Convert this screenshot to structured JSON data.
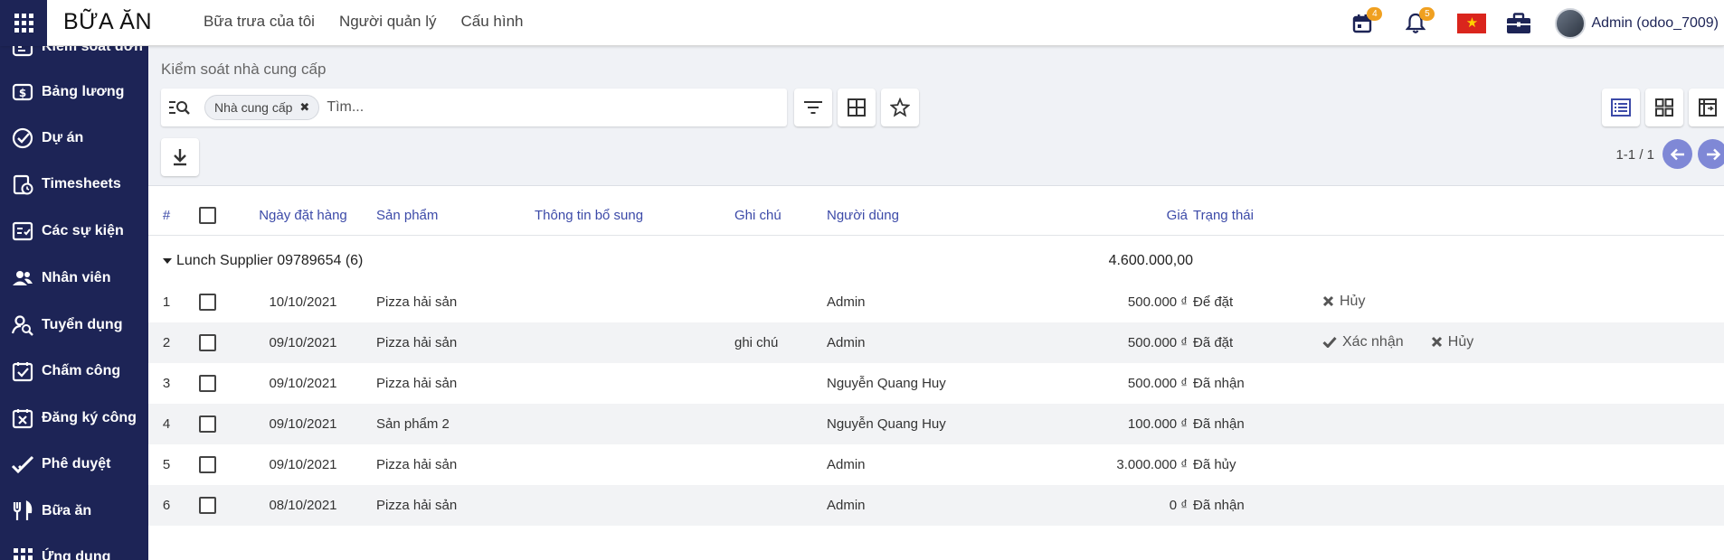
{
  "app": {
    "title": "BỮA ĂN",
    "menu": [
      "Bữa trưa của tôi",
      "Người quản lý",
      "Cấu hình"
    ],
    "activity_badge": "4",
    "notification_badge": "5",
    "user": "Admin (odoo_7009)"
  },
  "sidebar": {
    "items": [
      {
        "label": "Kiểm soát đơn",
        "icon": "order-control-icon"
      },
      {
        "label": "Bảng lương",
        "icon": "payroll-icon"
      },
      {
        "label": "Dự án",
        "icon": "project-check-icon"
      },
      {
        "label": "Timesheets",
        "icon": "timesheet-icon"
      },
      {
        "label": "Các sự kiện",
        "icon": "events-icon"
      },
      {
        "label": "Nhân viên",
        "icon": "employees-icon"
      },
      {
        "label": "Tuyển dụng",
        "icon": "recruitment-icon"
      },
      {
        "label": "Chấm công",
        "icon": "attendance-icon"
      },
      {
        "label": "Đăng ký công",
        "icon": "time-off-icon"
      },
      {
        "label": "Phê duyệt",
        "icon": "approval-icon"
      },
      {
        "label": "Bữa ăn",
        "icon": "lunch-icon"
      },
      {
        "label": "Ứng dụng",
        "icon": "apps-icon"
      }
    ]
  },
  "control_panel": {
    "breadcrumb": "Kiểm soát nhà cung cấp",
    "facet": "Nhà cung cấp",
    "search_placeholder": "Tìm...",
    "pager": "1-1 / 1"
  },
  "table": {
    "headers": {
      "num": "#",
      "date": "Ngày đặt hàng",
      "product": "Sản phẩm",
      "extra": "Thông tin bổ sung",
      "note": "Ghi chú",
      "user": "Người dùng",
      "price": "Giá",
      "state": "Trạng thái"
    },
    "group": {
      "label": "Lunch Supplier 09789654 (6)",
      "total": "4.600.000,00"
    },
    "rows": [
      {
        "n": "1",
        "date": "10/10/2021",
        "product": "Pizza hải sản",
        "note": "",
        "user": "Admin",
        "price": "500.000 ₫",
        "state": "Để đặt",
        "actions": [
          "Hủy"
        ]
      },
      {
        "n": "2",
        "date": "09/10/2021",
        "product": "Pizza hải sản",
        "note": "ghi chú",
        "user": "Admin",
        "price": "500.000 ₫",
        "state": "Đã đặt",
        "actions": [
          "Xác nhận",
          "Hủy"
        ]
      },
      {
        "n": "3",
        "date": "09/10/2021",
        "product": "Pizza hải sản",
        "note": "",
        "user": "Nguyễn Quang Huy",
        "price": "500.000 ₫",
        "state": "Đã nhận",
        "actions": []
      },
      {
        "n": "4",
        "date": "09/10/2021",
        "product": "Sản phẩm 2",
        "note": "",
        "user": "Nguyễn Quang Huy",
        "price": "100.000 ₫",
        "state": "Đã nhận",
        "actions": []
      },
      {
        "n": "5",
        "date": "09/10/2021",
        "product": "Pizza hải sản",
        "note": "",
        "user": "Admin",
        "price": "3.000.000 ₫",
        "state": "Đã hủy",
        "actions": []
      },
      {
        "n": "6",
        "date": "08/10/2021",
        "product": "Pizza hải sản",
        "note": "",
        "user": "Admin",
        "price": "0 ₫",
        "state": "Đã nhận",
        "actions": []
      }
    ]
  },
  "colors": {
    "sidebar": "#1d2456",
    "accent": "#3c4aa8",
    "badge": "#f0a020",
    "pager_button": "#7f88d6"
  }
}
